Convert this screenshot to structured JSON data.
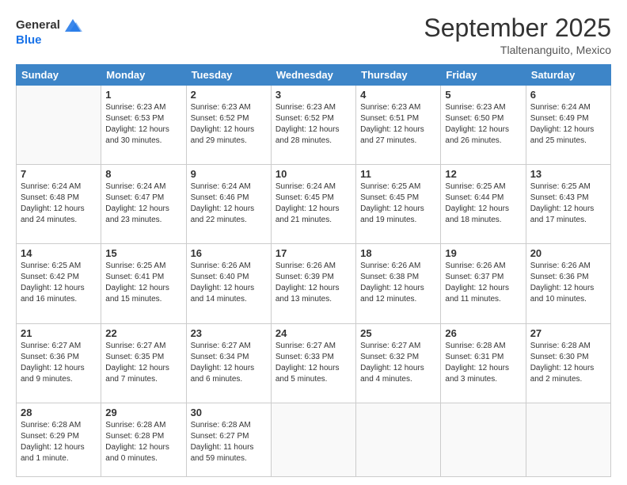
{
  "header": {
    "logo_line1": "General",
    "logo_line2": "Blue",
    "month": "September 2025",
    "location": "Tlaltenanguito, Mexico"
  },
  "days_of_week": [
    "Sunday",
    "Monday",
    "Tuesday",
    "Wednesday",
    "Thursday",
    "Friday",
    "Saturday"
  ],
  "weeks": [
    [
      {
        "day": "",
        "info": ""
      },
      {
        "day": "1",
        "info": "Sunrise: 6:23 AM\nSunset: 6:53 PM\nDaylight: 12 hours\nand 30 minutes."
      },
      {
        "day": "2",
        "info": "Sunrise: 6:23 AM\nSunset: 6:52 PM\nDaylight: 12 hours\nand 29 minutes."
      },
      {
        "day": "3",
        "info": "Sunrise: 6:23 AM\nSunset: 6:52 PM\nDaylight: 12 hours\nand 28 minutes."
      },
      {
        "day": "4",
        "info": "Sunrise: 6:23 AM\nSunset: 6:51 PM\nDaylight: 12 hours\nand 27 minutes."
      },
      {
        "day": "5",
        "info": "Sunrise: 6:23 AM\nSunset: 6:50 PM\nDaylight: 12 hours\nand 26 minutes."
      },
      {
        "day": "6",
        "info": "Sunrise: 6:24 AM\nSunset: 6:49 PM\nDaylight: 12 hours\nand 25 minutes."
      }
    ],
    [
      {
        "day": "7",
        "info": "Sunrise: 6:24 AM\nSunset: 6:48 PM\nDaylight: 12 hours\nand 24 minutes."
      },
      {
        "day": "8",
        "info": "Sunrise: 6:24 AM\nSunset: 6:47 PM\nDaylight: 12 hours\nand 23 minutes."
      },
      {
        "day": "9",
        "info": "Sunrise: 6:24 AM\nSunset: 6:46 PM\nDaylight: 12 hours\nand 22 minutes."
      },
      {
        "day": "10",
        "info": "Sunrise: 6:24 AM\nSunset: 6:45 PM\nDaylight: 12 hours\nand 21 minutes."
      },
      {
        "day": "11",
        "info": "Sunrise: 6:25 AM\nSunset: 6:45 PM\nDaylight: 12 hours\nand 19 minutes."
      },
      {
        "day": "12",
        "info": "Sunrise: 6:25 AM\nSunset: 6:44 PM\nDaylight: 12 hours\nand 18 minutes."
      },
      {
        "day": "13",
        "info": "Sunrise: 6:25 AM\nSunset: 6:43 PM\nDaylight: 12 hours\nand 17 minutes."
      }
    ],
    [
      {
        "day": "14",
        "info": "Sunrise: 6:25 AM\nSunset: 6:42 PM\nDaylight: 12 hours\nand 16 minutes."
      },
      {
        "day": "15",
        "info": "Sunrise: 6:25 AM\nSunset: 6:41 PM\nDaylight: 12 hours\nand 15 minutes."
      },
      {
        "day": "16",
        "info": "Sunrise: 6:26 AM\nSunset: 6:40 PM\nDaylight: 12 hours\nand 14 minutes."
      },
      {
        "day": "17",
        "info": "Sunrise: 6:26 AM\nSunset: 6:39 PM\nDaylight: 12 hours\nand 13 minutes."
      },
      {
        "day": "18",
        "info": "Sunrise: 6:26 AM\nSunset: 6:38 PM\nDaylight: 12 hours\nand 12 minutes."
      },
      {
        "day": "19",
        "info": "Sunrise: 6:26 AM\nSunset: 6:37 PM\nDaylight: 12 hours\nand 11 minutes."
      },
      {
        "day": "20",
        "info": "Sunrise: 6:26 AM\nSunset: 6:36 PM\nDaylight: 12 hours\nand 10 minutes."
      }
    ],
    [
      {
        "day": "21",
        "info": "Sunrise: 6:27 AM\nSunset: 6:36 PM\nDaylight: 12 hours\nand 9 minutes."
      },
      {
        "day": "22",
        "info": "Sunrise: 6:27 AM\nSunset: 6:35 PM\nDaylight: 12 hours\nand 7 minutes."
      },
      {
        "day": "23",
        "info": "Sunrise: 6:27 AM\nSunset: 6:34 PM\nDaylight: 12 hours\nand 6 minutes."
      },
      {
        "day": "24",
        "info": "Sunrise: 6:27 AM\nSunset: 6:33 PM\nDaylight: 12 hours\nand 5 minutes."
      },
      {
        "day": "25",
        "info": "Sunrise: 6:27 AM\nSunset: 6:32 PM\nDaylight: 12 hours\nand 4 minutes."
      },
      {
        "day": "26",
        "info": "Sunrise: 6:28 AM\nSunset: 6:31 PM\nDaylight: 12 hours\nand 3 minutes."
      },
      {
        "day": "27",
        "info": "Sunrise: 6:28 AM\nSunset: 6:30 PM\nDaylight: 12 hours\nand 2 minutes."
      }
    ],
    [
      {
        "day": "28",
        "info": "Sunrise: 6:28 AM\nSunset: 6:29 PM\nDaylight: 12 hours\nand 1 minute."
      },
      {
        "day": "29",
        "info": "Sunrise: 6:28 AM\nSunset: 6:28 PM\nDaylight: 12 hours\nand 0 minutes."
      },
      {
        "day": "30",
        "info": "Sunrise: 6:28 AM\nSunset: 6:27 PM\nDaylight: 11 hours\nand 59 minutes."
      },
      {
        "day": "",
        "info": ""
      },
      {
        "day": "",
        "info": ""
      },
      {
        "day": "",
        "info": ""
      },
      {
        "day": "",
        "info": ""
      }
    ]
  ]
}
